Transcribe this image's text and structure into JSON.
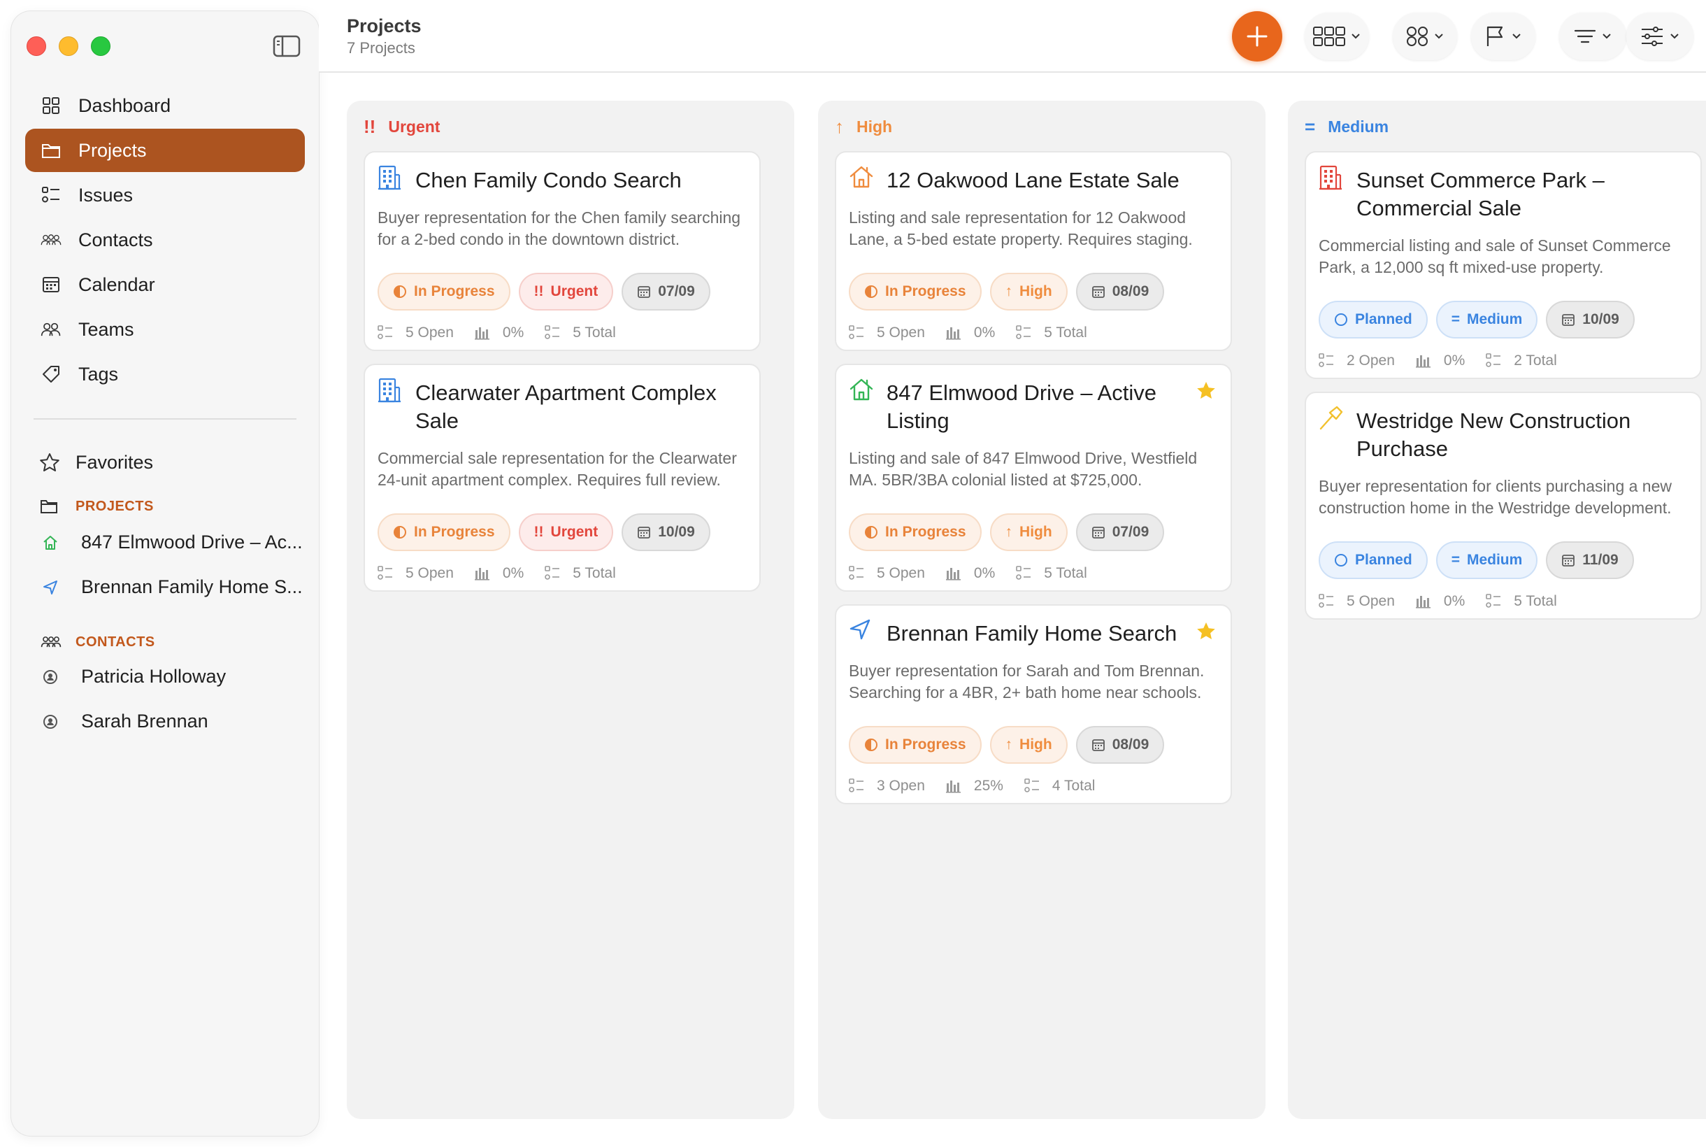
{
  "sidebar": {
    "nav": [
      {
        "label": "Dashboard",
        "icon": "grid-icon"
      },
      {
        "label": "Projects",
        "icon": "folder-icon",
        "active": true
      },
      {
        "label": "Issues",
        "icon": "checklist-icon"
      },
      {
        "label": "Contacts",
        "icon": "people-icon"
      },
      {
        "label": "Calendar",
        "icon": "calendar-icon"
      },
      {
        "label": "Teams",
        "icon": "team-icon"
      },
      {
        "label": "Tags",
        "icon": "tag-icon"
      }
    ],
    "favorites_label": "Favorites",
    "projects_heading": "PROJECTS",
    "projects": [
      {
        "label": "847 Elmwood Drive – Ac...",
        "icon": "house-icon"
      },
      {
        "label": "Brennan Family Home S...",
        "icon": "navigation-arrow-icon"
      }
    ],
    "contacts_heading": "CONTACTS",
    "contacts": [
      {
        "label": "Patricia Holloway",
        "icon": "person-circle-icon"
      },
      {
        "label": "Sarah Brennan",
        "icon": "person-circle-icon"
      }
    ]
  },
  "header": {
    "title": "Projects",
    "subtitle": "7 Projects"
  },
  "toolbar": {
    "accent": "#e8661c",
    "buttons": [
      "layout-grid-icon",
      "group-icon",
      "flag-filter-icon",
      "sort-icon",
      "filter-sliders-icon"
    ]
  },
  "columns": [
    {
      "label": "Urgent",
      "symbol": "!!",
      "color": "#e2463c",
      "cards": [
        {
          "title": "Chen Family Condo Search",
          "icon": "building-icon",
          "starred": false,
          "desc": "Buyer representation for the Chen family searching for a 2-bed condo in the downtown district.",
          "status": "In Progress",
          "priority": "Urgent",
          "date": "07/09",
          "open": "5 Open",
          "progress": "0%",
          "total": "5 Total"
        },
        {
          "title": "Clearwater Apartment Complex Sale",
          "icon": "building-icon",
          "starred": false,
          "desc": "Commercial sale representation for the Clearwater 24-unit apartment complex. Requires full review.",
          "status": "In Progress",
          "priority": "Urgent",
          "date": "10/09",
          "open": "5 Open",
          "progress": "0%",
          "total": "5 Total"
        }
      ]
    },
    {
      "label": "High",
      "symbol": "↑",
      "color": "#ef8c3e",
      "cards": [
        {
          "title": "12 Oakwood Lane Estate Sale",
          "icon": "house-icon",
          "starred": false,
          "desc": "Listing and sale representation for 12 Oakwood Lane, a 5-bed estate property. Requires staging.",
          "status": "In Progress",
          "priority": "High",
          "date": "08/09",
          "open": "5 Open",
          "progress": "0%",
          "total": "5 Total"
        },
        {
          "title": "847 Elmwood Drive – Active Listing",
          "icon": "house-icon",
          "starred": true,
          "desc": "Listing and sale of 847 Elmwood Drive, Westfield MA. 5BR/3BA colonial listed at $725,000.",
          "status": "In Progress",
          "priority": "High",
          "date": "07/09",
          "open": "5 Open",
          "progress": "0%",
          "total": "5 Total"
        },
        {
          "title": "Brennan Family Home Search",
          "icon": "navigation-arrow-icon",
          "starred": true,
          "desc": "Buyer representation for Sarah and Tom Brennan. Searching for a 4BR, 2+ bath home near schools.",
          "status": "In Progress",
          "priority": "High",
          "date": "08/09",
          "open": "3 Open",
          "progress": "25%",
          "total": "4 Total"
        }
      ]
    },
    {
      "label": "Medium",
      "symbol": "=",
      "color": "#3a84e0",
      "cards": [
        {
          "title": "Sunset Commerce Park – Commercial Sale",
          "icon": "building-icon",
          "starred": false,
          "desc": "Commercial listing and sale of Sunset Commerce Park, a 12,000 sq ft mixed-use property.",
          "status": "Planned",
          "priority": "Medium",
          "date": "10/09",
          "open": "2 Open",
          "progress": "0%",
          "total": "2 Total"
        },
        {
          "title": "Westridge New Construction Purchase",
          "icon": "hammer-icon",
          "starred": false,
          "desc": "Buyer representation for clients purchasing a new construction home in the Westridge development.",
          "status": "Planned",
          "priority": "Medium",
          "date": "11/09",
          "open": "5 Open",
          "progress": "0%",
          "total": "5 Total"
        }
      ]
    }
  ]
}
